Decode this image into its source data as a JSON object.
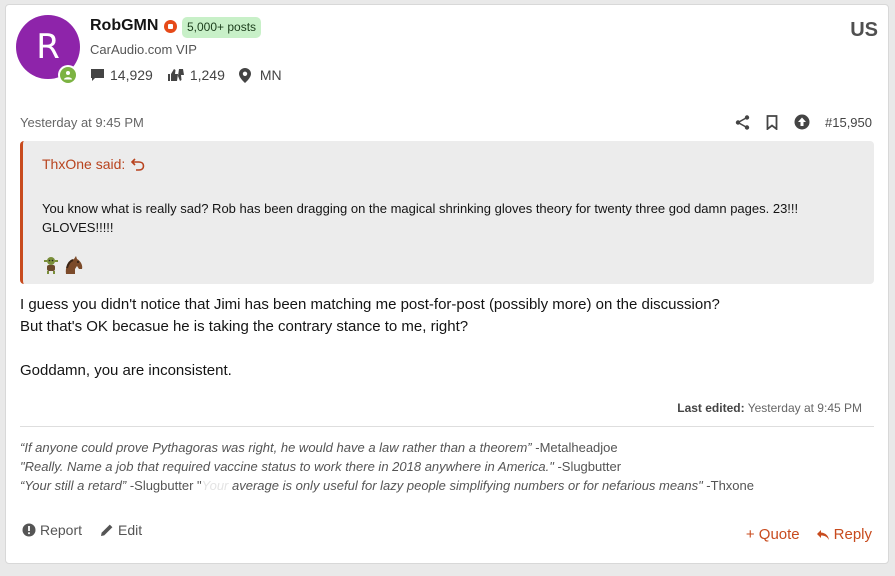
{
  "user": {
    "avatar_letter": "R",
    "avatar_color": "#8e24aa",
    "name": "RobGMN",
    "posts_badge": "5,000+ posts",
    "title": "CarAudio.com VIP",
    "messages_count": "14,929",
    "reactions_count": "1,249",
    "location": "MN",
    "country_flag": "US",
    "status_icon": "online-icon"
  },
  "post": {
    "date": "Yesterday at 9:45 PM",
    "number": "#15,950",
    "tools": [
      "share-icon",
      "bookmark-icon",
      "upvote-icon"
    ]
  },
  "quote": {
    "author_said": "ThxOne said:",
    "text": "You know what is really sad? Rob has been dragging on the magical shrinking gloves theory for twenty three god damn pages. 23!!! GLOVES!!!!!",
    "emojis": [
      "🧌",
      "🐴"
    ],
    "accent": "#c84b1e"
  },
  "body": {
    "line1": "I guess you didn't notice that Jimi has been matching me post-for-post (possibly more) on the discussion?",
    "line2": "But that's OK becasue he is taking the contrary stance to me, right?",
    "line3": "Goddamn, you are inconsistent."
  },
  "edited": {
    "label": "Last edited:",
    "value": "Yesterday at 9:45 PM"
  },
  "signature": {
    "line1_quote": "“If anyone could prove Pythagoras was right, he would have a law rather than a theorem”",
    "line1_author": " -Metalheadjoe",
    "line2_quote": "\"Really. Name a job that required vaccine status to work there in 2018 anywhere in America.\"",
    "line2_author": " -Slugbutter",
    "line3_quote": "“Your still a retard”",
    "line3_mid": " -Slugbutter \"",
    "line3_ghost": "Your",
    "line3_quote2": " average is only useful for lazy people simplifying numbers or for nefarious means\"",
    "line3_author": " -Thxone"
  },
  "actions": {
    "report": "Report",
    "edit": "Edit",
    "quote": "+ Quote",
    "reply": "Reply"
  }
}
